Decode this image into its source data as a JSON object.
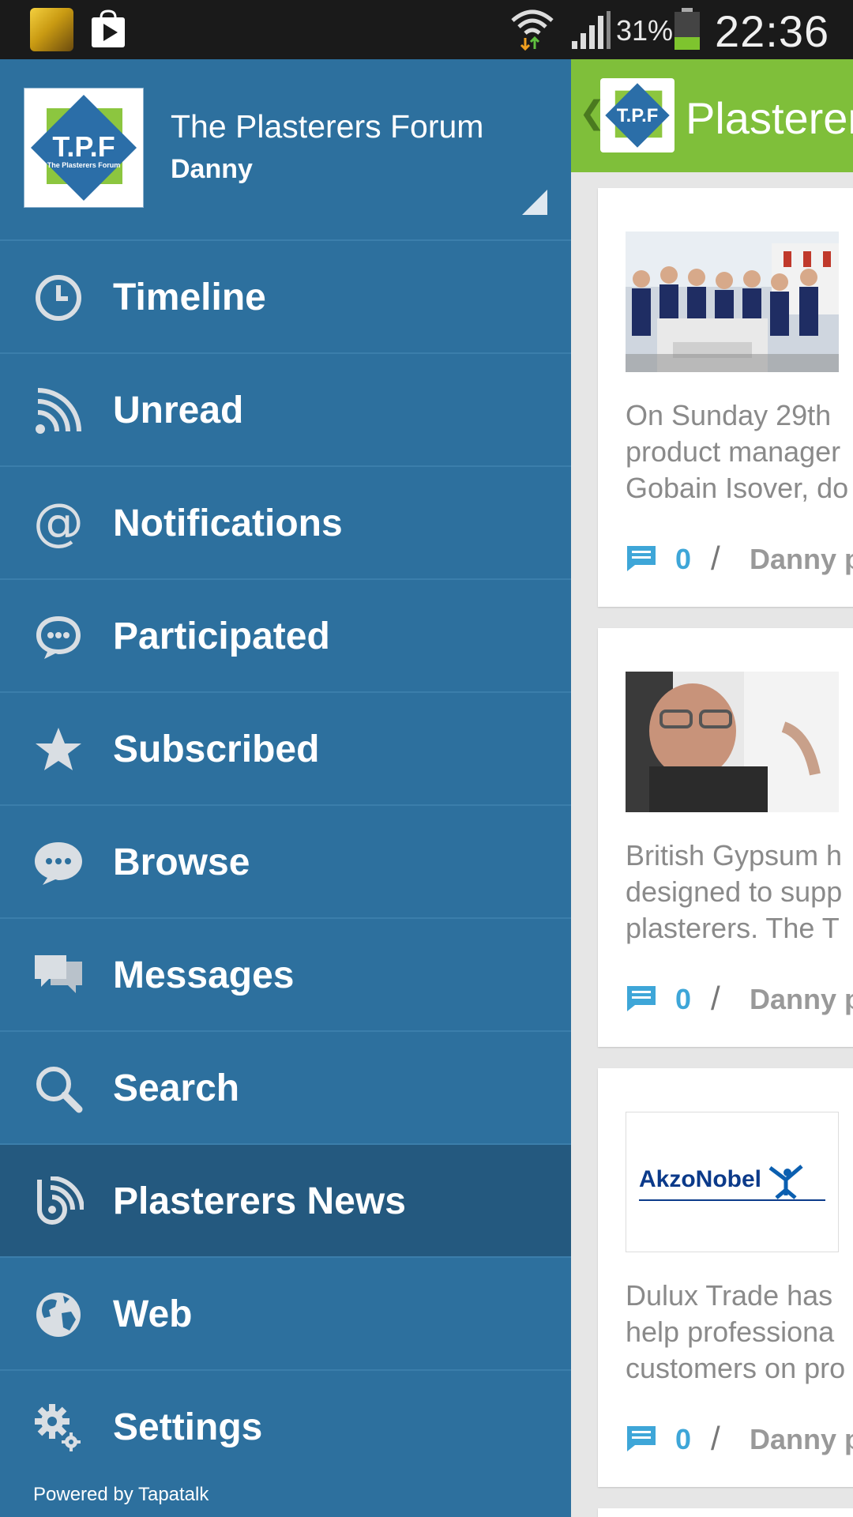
{
  "status_bar": {
    "battery_percent": "31%",
    "time": "22:36"
  },
  "drawer": {
    "forum_name": "The Plasterers Forum",
    "user_name": "Danny",
    "logo_text": "T.P.F",
    "logo_subtext": "The Plasterers Forum",
    "menu": [
      {
        "label": "Timeline",
        "icon": "clock-icon",
        "active": false
      },
      {
        "label": "Unread",
        "icon": "rss-icon",
        "active": false
      },
      {
        "label": "Notifications",
        "icon": "at-icon",
        "active": false
      },
      {
        "label": "Participated",
        "icon": "chat-bubble-icon",
        "active": false
      },
      {
        "label": "Subscribed",
        "icon": "star-icon",
        "active": false
      },
      {
        "label": "Browse",
        "icon": "speech-bubble-icon",
        "active": false
      },
      {
        "label": "Messages",
        "icon": "messages-icon",
        "active": false
      },
      {
        "label": "Search",
        "icon": "search-icon",
        "active": false
      },
      {
        "label": "Plasterers News",
        "icon": "news-feed-icon",
        "active": true
      },
      {
        "label": "Web",
        "icon": "globe-icon",
        "active": false
      },
      {
        "label": "Settings",
        "icon": "gear-icon",
        "active": false
      }
    ],
    "footer": "Powered by Tapatalk"
  },
  "content": {
    "header_title": "Plasterers News",
    "cards": [
      {
        "text_lines": [
          "On Sunday 29th",
          "product manager",
          "Gobain Isover, do"
        ],
        "comment_count": "0",
        "separator": "/",
        "author": "Danny p"
      },
      {
        "text_lines": [
          "British Gypsum h",
          "designed to supp",
          "plasterers. The T"
        ],
        "comment_count": "0",
        "separator": "/",
        "author": "Danny p"
      },
      {
        "image_logo_text": "AkzoNobel",
        "text_lines": [
          "Dulux Trade has",
          "help professiona",
          "customers on pro"
        ],
        "comment_count": "0",
        "separator": "/",
        "author": "Danny p"
      }
    ]
  },
  "colors": {
    "drawer_bg": "#2d709e",
    "drawer_active": "#24597f",
    "header_green": "#7fbf3a",
    "accent_blue": "#3ea6d8",
    "status_bar": "#1a1a1a"
  }
}
